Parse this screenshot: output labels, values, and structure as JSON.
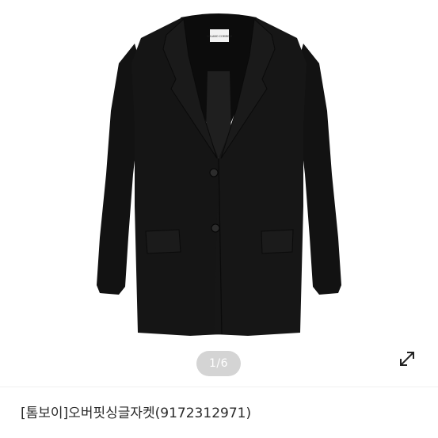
{
  "gallery": {
    "image": "black oversized single-breasted blazer",
    "label_text": "SOLANO COMMON",
    "page_indicator": "1/6",
    "expand_icon": "expand-arrows-icon"
  },
  "product": {
    "title": "[톰보이]오버핏싱글자켓(9172312971)"
  },
  "colors": {
    "jacket": "#141414",
    "indicator_bg": "#d4d4d4",
    "title_text": "#2a2a2a"
  }
}
